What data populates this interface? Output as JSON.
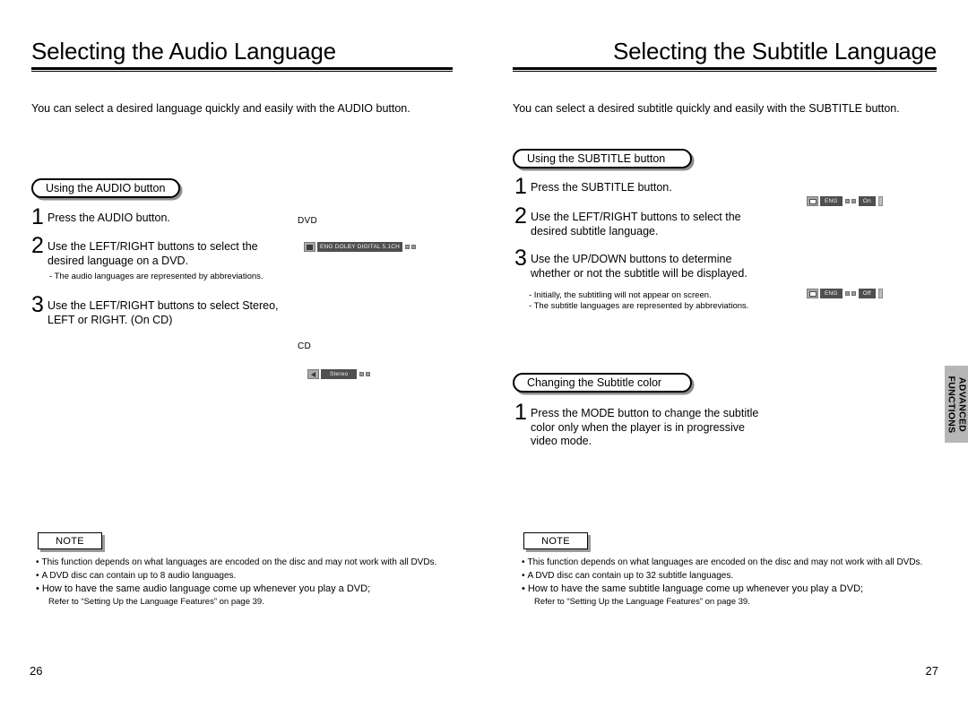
{
  "left_page": {
    "title": "Selecting the Audio Language",
    "intro": "You can select a desired language quickly and easily with the AUDIO button.",
    "section_tab": "Using the AUDIO button",
    "steps": [
      {
        "num": "1",
        "text": "Press the AUDIO button."
      },
      {
        "num": "2",
        "text": "Use the LEFT/RIGHT buttons to select the\ndesired language on a DVD."
      },
      {
        "num": "3",
        "text": "Use the LEFT/RIGHT buttons to select Stereo,\nLEFT or RIGHT. (On CD)"
      }
    ],
    "subnote": "- The audio languages are represented by abbreviations.",
    "osd_dvd": {
      "caption": "DVD",
      "text": "ENG  DOLBY DIGITAL  5.1CH"
    },
    "osd_cd": {
      "caption": "CD",
      "text": "Stereo"
    },
    "note": {
      "label": "NOTE",
      "items": [
        "This function depends on what languages are encoded on the disc and may not work with all DVDs.",
        "A DVD disc can contain up to 8 audio languages.",
        "How to have the same audio language come up whenever you play  a DVD;"
      ],
      "sub": "Refer to “Setting Up the Language Features” on page 39."
    },
    "folio": "26"
  },
  "right_page": {
    "title": "Selecting the Subtitle Language",
    "intro": "You can select a desired subtitle quickly and easily with the SUBTITLE button.",
    "section_tab": "Using the SUBTITLE button",
    "steps": [
      {
        "num": "1",
        "text": "Press the SUBTITLE button."
      },
      {
        "num": "2",
        "text": "Use the LEFT/RIGHT buttons to select the\ndesired subtitle language."
      },
      {
        "num": "3",
        "text": "Use the UP/DOWN buttons to determine\nwhether or not the subtitle will be displayed."
      }
    ],
    "subnote": "- Initially, the subtitling will not appear on screen.\n- The subtitle languages are represented by abbreviations.",
    "osd_on": {
      "lang": "ENG",
      "state": "On"
    },
    "osd_off": {
      "lang": "ENG",
      "state": "Off"
    },
    "color_tab": "Changing the Subtitle color",
    "color_step": {
      "num": "1",
      "text": "Press the MODE button to change the subtitle\ncolor only when the player is in progressive\nvideo mode."
    },
    "note": {
      "label": "NOTE",
      "items": [
        "This function depends on what languages are encoded on the disc and may not work with all DVDs.",
        "A DVD disc can contain up to 32 subtitle languages.",
        "How to have the same subtitle language come up whenever you play  a DVD;"
      ],
      "sub": "Refer to “Setting Up the Language Features” on page 39."
    },
    "folio": "27"
  },
  "side_tab": {
    "line1": "ADVANCED",
    "line2": "FUNCTIONS"
  },
  "bullet": "•"
}
